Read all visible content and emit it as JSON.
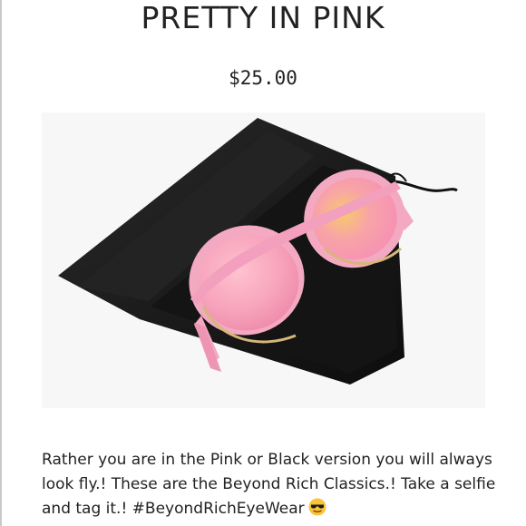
{
  "listing": {
    "title": "PRETTY IN PINK",
    "price": "$25.00",
    "description": "Rather you are in the Pink or Black version you will always look fly.! These are the Beyond Rich Classics.! Take a selfie and tag it.! #BeyondRichEyeWear",
    "description_emoji": "sunglasses-face-emoji"
  },
  "colors": {
    "frame_pink": "#f4a9c3",
    "lens_pink": "#f7a0b6",
    "pouch_black": "#161616",
    "photo_bg": "#f7f7f7",
    "text": "#222222"
  }
}
